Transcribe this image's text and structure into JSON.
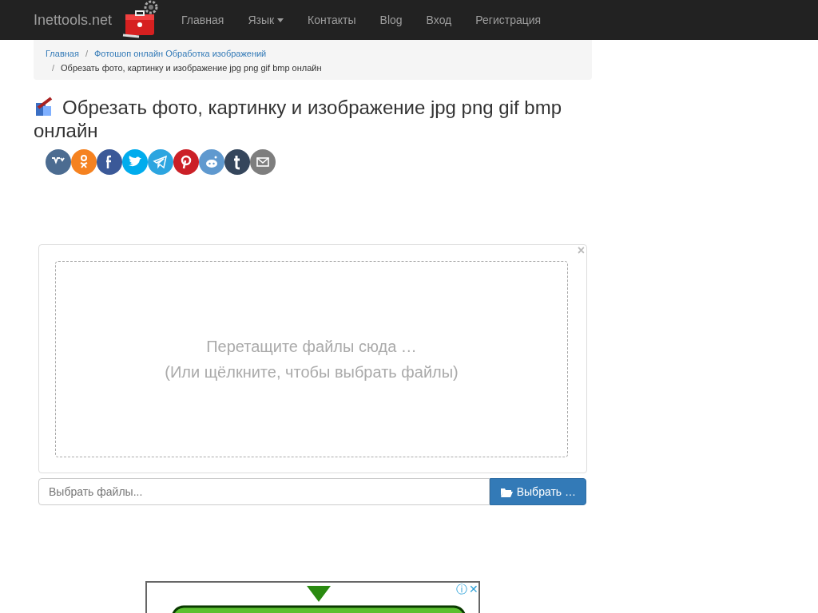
{
  "navbar": {
    "brand": "Inettools.net",
    "items": [
      {
        "label": "Главная",
        "dropdown": false
      },
      {
        "label": "Язык",
        "dropdown": true
      },
      {
        "label": "Контакты",
        "dropdown": false
      },
      {
        "label": "Blog",
        "dropdown": false
      },
      {
        "label": "Вход",
        "dropdown": false
      },
      {
        "label": "Регистрация",
        "dropdown": false
      }
    ]
  },
  "breadcrumb": [
    {
      "label": "Главная",
      "link": true
    },
    {
      "separator": "/",
      "label": "Фотошоп онлайн Обработка изображений",
      "link": true
    },
    {
      "separator": "/",
      "label": "Обрезать фото, картинку и изображение jpg png gif bmp онлайн",
      "link": false
    }
  ],
  "title": "Обрезать фото, картинку и изображение jpg png gif bmp онлайн",
  "share": [
    {
      "color": "#4c6c91"
    },
    {
      "color": "#f58220"
    },
    {
      "color": "#3b5998"
    },
    {
      "color": "#00aced"
    },
    {
      "color": "#2ca5e0"
    },
    {
      "color": "#cb2027"
    },
    {
      "color": "#5f99cf"
    },
    {
      "color": "#35465c"
    },
    {
      "color": "#7e7e7e"
    }
  ],
  "dropzone": {
    "close": "×",
    "line1": "Перетащите файлы сюда …",
    "line2": "(Или щёлкните, чтобы выбрать файлы)"
  },
  "file_input": {
    "placeholder": "Выбрать файлы...",
    "button": "Выбрать …"
  },
  "ad": {
    "info": "ⓘ",
    "close": "✕"
  }
}
